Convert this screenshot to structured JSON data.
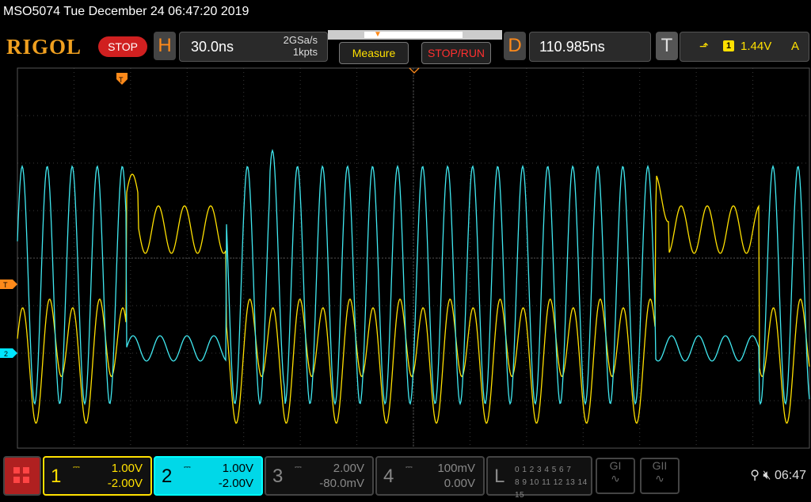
{
  "header": {
    "title": "MSO5074  Tue December 24 06:47:20 2019",
    "logo": "RIGOL",
    "run_state": "STOP",
    "horizontal": {
      "letter": "H",
      "timebase": "30.0ns",
      "sample_rate": "2GSa/s",
      "memory_depth": "1kpts"
    },
    "measure_label": "Measure",
    "stop_run_label": "STOP/RUN",
    "delay": {
      "letter": "D",
      "value": "110.985ns"
    },
    "trigger": {
      "letter": "T",
      "source": "1",
      "level": "1.44V",
      "mode": "A"
    }
  },
  "markers": {
    "trigger_level": "T",
    "channel2": "2"
  },
  "channels": [
    {
      "num": "1",
      "scale": "1.00V",
      "offset": "-2.00V",
      "color": "#ffe000"
    },
    {
      "num": "2",
      "scale": "1.00V",
      "offset": "-2.00V",
      "color": "#00e5ff"
    },
    {
      "num": "3",
      "scale": "2.00V",
      "offset": "-80.0mV"
    },
    {
      "num": "4",
      "scale": "100mV",
      "offset": "0.00V"
    }
  ],
  "logic": {
    "letter": "L",
    "row1": "0 1 2 3  4 5 6 7",
    "row2": "8 9 10 11 12 13 14 15"
  },
  "gi": "GI",
  "gii": "GII",
  "clock": "06:47"
}
